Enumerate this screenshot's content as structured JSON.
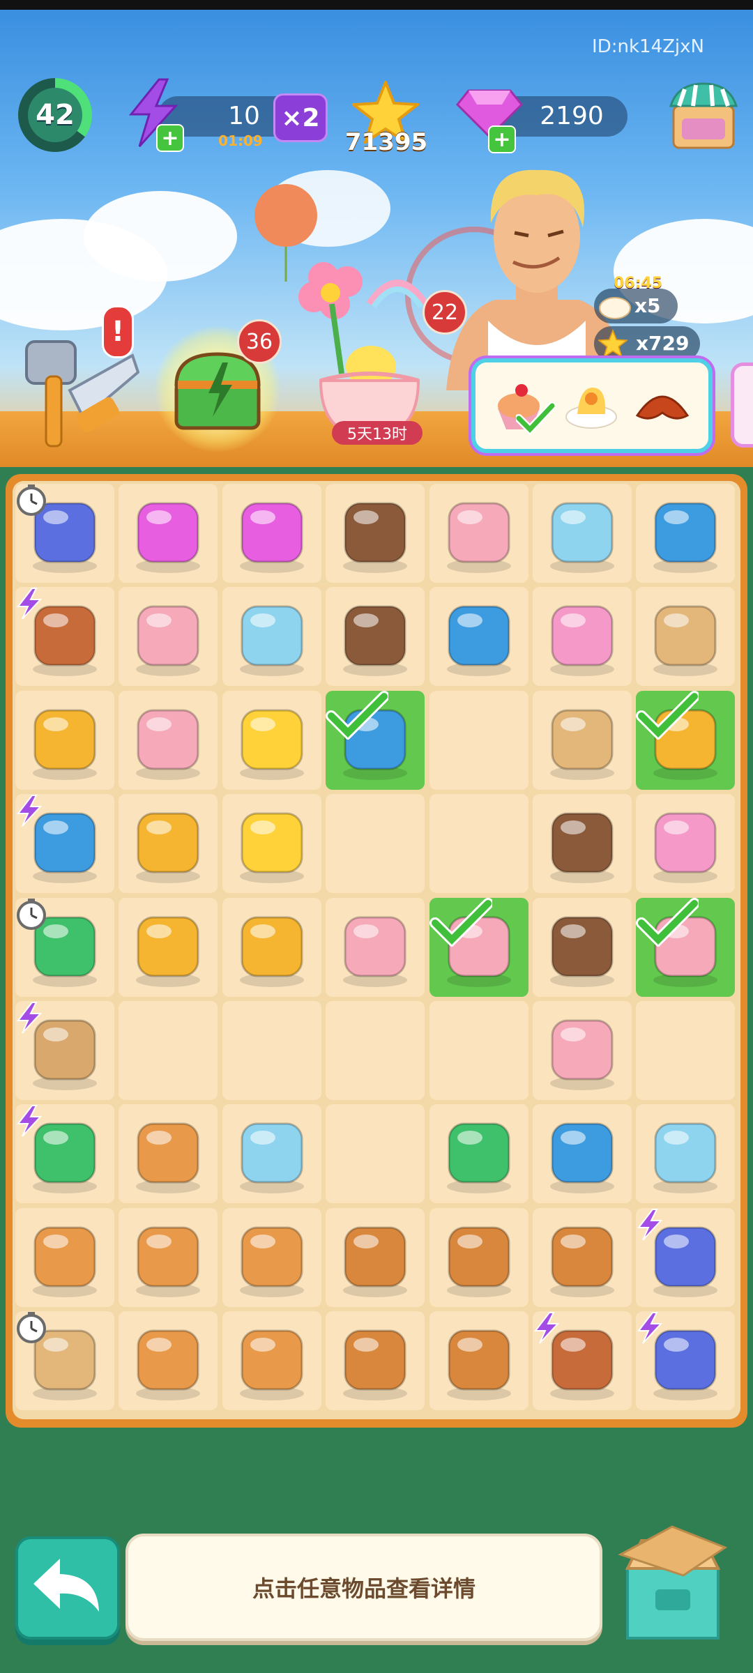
{
  "player_id": "ID:nk14ZjxN",
  "hud": {
    "level": "42",
    "energy": "10",
    "energy_timer": "01:09",
    "multiplier": "×2",
    "stars": "71395",
    "gems": "2190",
    "level_progress_fraction": 0.35
  },
  "events": {
    "alert_mark": "!",
    "chest_badge": "36",
    "flower_badge": "22",
    "flower_countdown": "5天13时"
  },
  "character_offer": {
    "timer": "06:45",
    "reward_item_count": "x5",
    "reward_star_count": "x729"
  },
  "orders": [
    "cupcake-icon",
    "sandwich-icon",
    "croissant-icon"
  ],
  "hint_text": "点击任意物品查看详情",
  "colors": {
    "board": "#e48b2c",
    "cell": "#fbe4bd",
    "done": "#62c94e",
    "accent": "#2fbfa6"
  },
  "board": [
    [
      "makeup-kit-icon",
      "gems-pile-icon",
      "gem-icon",
      "cocoa-mug-icon",
      "strawberry-cake-icon",
      "perfume-bottle-icon",
      "popup-castle-book-icon"
    ],
    [
      "flower-pot-icon",
      "honey-pancake-icon",
      "snow-globe-icon",
      "latte-cup-icon",
      "blue-book-icon",
      "love-letter-icon",
      "purple-box-icon"
    ],
    [
      "beehive-icon",
      "honeycomb-cake-icon",
      "stars-cluster-icon",
      "storybook-icon",
      "",
      "heart-box-icon",
      "honey-jar-glass-icon"
    ],
    [
      "bookshelf-icon",
      "honey-dipper-icon",
      "star-icon",
      "",
      "",
      "coffee-cup-icon",
      "pink-note-icon"
    ],
    [
      "vending-machine-icon",
      "honey-jar-icon",
      "honeycomb-icon",
      "matcha-cupcake-icon",
      "cake-slice-icon",
      "takeaway-coffee-icon",
      "cherry-cupcake-icon"
    ],
    [
      "tea-table-icon",
      "",
      "",
      "",
      "",
      "matcha-cupcake-icon",
      ""
    ],
    [
      "picnic-basket-icon",
      "sleeping-dog-icon",
      "cologne-bottle-icon",
      "",
      "energy-bolt-icon",
      "photo-book-icon",
      "lemonade-icon"
    ],
    [
      "hoodie-dog-icon",
      "ham-dog-icon",
      "toilet-dog-icon",
      "sandwich-icon",
      "bread-tray-icon",
      "bun-tray-icon",
      "vanity-cart-icon"
    ],
    [
      "cardboard-box-icon",
      "scarf-dog-icon",
      "bowl-dog-icon",
      "bread-loaf-icon",
      "bagel-icon",
      "tulip-pot-icon",
      "makeup-case-icon"
    ]
  ],
  "completed_cells": [
    "2-3",
    "2-6",
    "4-4",
    "4-6"
  ]
}
